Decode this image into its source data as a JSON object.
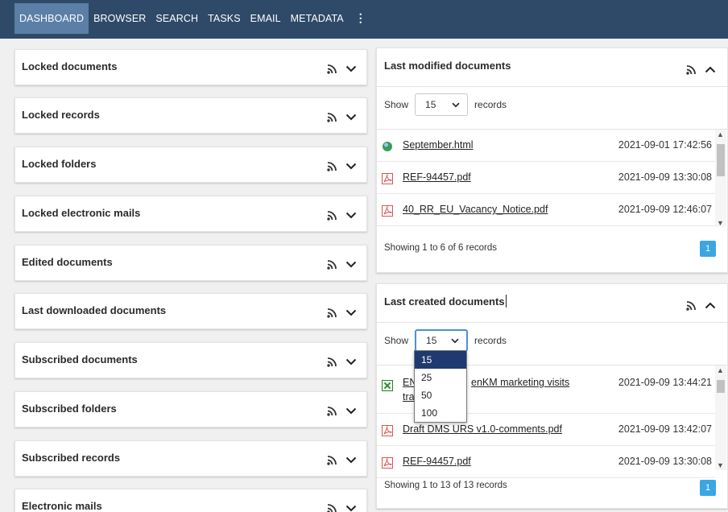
{
  "nav": {
    "items": [
      "DASHBOARD",
      "BROWSER",
      "SEARCH",
      "TASKS",
      "EMAIL",
      "METADATA"
    ],
    "more": "⋮"
  },
  "left_panels": [
    "Locked documents",
    "Locked records",
    "Locked folders",
    "Locked electronic mails",
    "Edited documents",
    "Last downloaded documents",
    "Subscribed documents",
    "Subscribed folders",
    "Subscribed records",
    "Electronic mails"
  ],
  "last_modified": {
    "title": "Last modified documents",
    "show_label": "Show",
    "records_label": "records",
    "page_size": "15",
    "rows": [
      {
        "name": "September.html",
        "date": "2021-09-01 17:42:56",
        "icon": "web-icon"
      },
      {
        "name": "REF-94457.pdf",
        "date": "2021-09-09 13:30:08",
        "icon": "pdf-icon"
      },
      {
        "name": "40_RR_EU_Vacancy_Notice.pdf",
        "date": "2021-09-09 12:46:07",
        "icon": "pdf-icon"
      }
    ],
    "footer": "Showing 1 to 6 of 6 records",
    "page": "1"
  },
  "last_created": {
    "title": "Last created documents",
    "show_label": "Show",
    "records_label": "records",
    "page_size": "15",
    "page_size_options": [
      "15",
      "25",
      "50",
      "100"
    ],
    "rows": [
      {
        "name_line1": "EN",
        "name_line1b": "enKM marketing visits",
        "name_line2": "tra",
        "date": "2021-09-09 13:44:21",
        "icon": "excel-icon"
      },
      {
        "name": "Draft DMS URS v1.0-comments.pdf",
        "date": "2021-09-09 13:42:07",
        "icon": "pdf-icon"
      },
      {
        "name": "REF-94457.pdf",
        "date": "2021-09-09 13:30:08",
        "icon": "pdf-icon"
      }
    ],
    "footer": "Showing 1 to 13 of 13 records",
    "page": "1"
  },
  "colors": {
    "topbar": "#2f4a68",
    "nav_active": "#5b7fa6",
    "page_button": "#3aa7e2",
    "dropdown_selected": "#1e3a6e"
  }
}
